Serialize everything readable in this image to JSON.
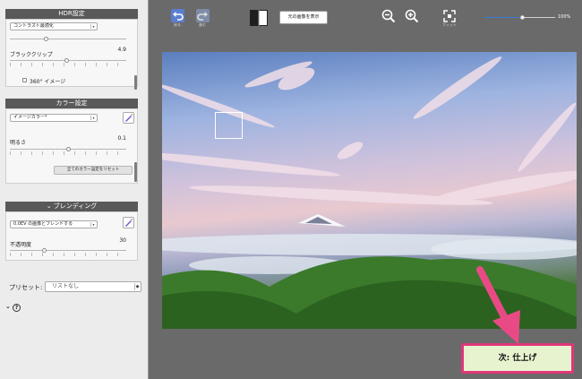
{
  "hdr": {
    "title": "HDR設定",
    "preset_select": "コントラスト最適化",
    "black_clip_label": "ブラッククリップ",
    "black_clip_value": "4.9",
    "black_clip_level": 0.49,
    "image360_label": "360° イメージ"
  },
  "color": {
    "title": "カラー設定",
    "color_select": "イメージカラー*",
    "brightness_label": "明るさ",
    "brightness_value": "0.1",
    "brightness_level": 0.51,
    "reset_label": "全てのカラー設定をリセット"
  },
  "blending": {
    "title": "ブレンディング",
    "mode_select": "0.0EV の画像とブレンドする",
    "opacity_label": "不透明度",
    "opacity_value": "30",
    "opacity_level": 0.3
  },
  "preset": {
    "label": "プリセット:",
    "value": "リストなし"
  },
  "toolbar": {
    "undo_label": "戻る",
    "redo_label": "進む",
    "show_original_label": "元の画像を表示",
    "fit_label": "フィット",
    "zoom_percent": "100%",
    "zoom_level": 0.55
  },
  "next_button_label": "次: 仕上げ",
  "colors": {
    "panel_title_bg": "#595959",
    "next_button_bg": "#e7f3cf",
    "next_button_border": "#e0377a",
    "arrow": "#e94a86"
  }
}
